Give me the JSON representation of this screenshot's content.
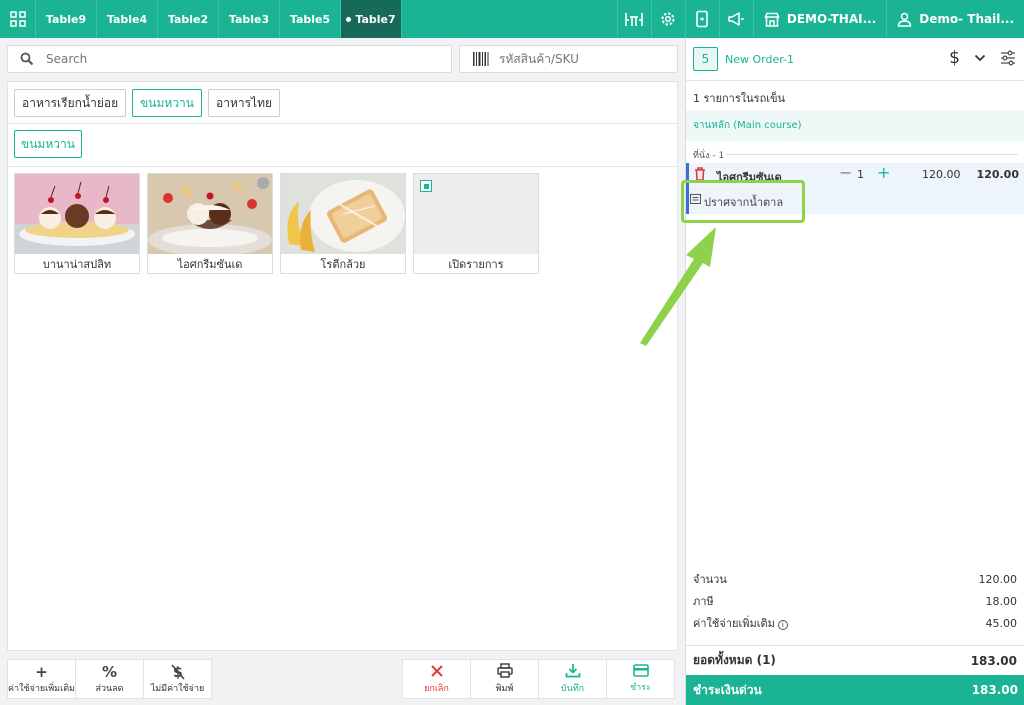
{
  "topbar": {
    "tabs": [
      {
        "label": "Table9",
        "active": false
      },
      {
        "label": "Table4",
        "active": false
      },
      {
        "label": "Table2",
        "active": false
      },
      {
        "label": "Table3",
        "active": false
      },
      {
        "label": "Table5",
        "active": false
      },
      {
        "label": "Table7",
        "active": true
      }
    ],
    "store_label": "DEMO-THAI...",
    "user_label": "Demo- Thail...",
    "accent_color": "#1ab394",
    "active_tab_color": "#176a5a"
  },
  "search": {
    "placeholder": "Search"
  },
  "sku": {
    "placeholder": "รหัสสินค้า/SKU"
  },
  "categories": [
    {
      "label": "อาหารเรียกน้ำย่อย",
      "active": false
    },
    {
      "label": "ขนมหวาน",
      "active": true
    },
    {
      "label": "อาหารไทย",
      "active": false
    }
  ],
  "subcategory": {
    "label": "ขนมหวาน"
  },
  "products": [
    {
      "name": "บานาน่าสปลิท",
      "icon": "banana-split-image"
    },
    {
      "name": "ไอศกรีมซันเด",
      "icon": "sundae-image"
    },
    {
      "name": "โรตีกล้วย",
      "icon": "banana-roti-image"
    },
    {
      "name": "เปิดรายการ",
      "icon": "open-item-image"
    }
  ],
  "bottom_left": [
    {
      "label": "ค่าใช้จ่ายเพิ่มเติม",
      "icon": "plus-icon"
    },
    {
      "label": "ส่วนลด",
      "icon": "percent-icon"
    },
    {
      "label": "ไม่มีค่าใช้จ่าย",
      "icon": "no-charge-icon"
    }
  ],
  "bottom_right": [
    {
      "label": "ยกเลิก",
      "icon": "close-icon"
    },
    {
      "label": "พิมพ์",
      "icon": "print-icon"
    },
    {
      "label": "บันทึก",
      "icon": "download-icon"
    },
    {
      "label": "ชำระ",
      "icon": "card-icon"
    }
  ],
  "order": {
    "count": "5",
    "name": "New Order-1",
    "items_count": "1 รายการในรถเข็น",
    "course": "จานหลัก (Main course)",
    "seat": "ที่นั่ง - 1",
    "item": {
      "name": "ไอศกรีมซันเด",
      "qty": "1",
      "price": "120.00",
      "total": "120.00",
      "note": "ปราศจากน้ำตาล"
    },
    "summary": {
      "subtotal_label": "จำนวน",
      "subtotal": "120.00",
      "tax_label": "ภาษี",
      "tax": "18.00",
      "extra_label": "ค่าใช้จ่ายเพิ่มเติม",
      "extra": "45.00"
    },
    "total_label": "ยอดทั้งหมด  (1)",
    "total": "183.00",
    "pay_label": "ชำระเงินด่วน",
    "pay_total": "183.00"
  }
}
